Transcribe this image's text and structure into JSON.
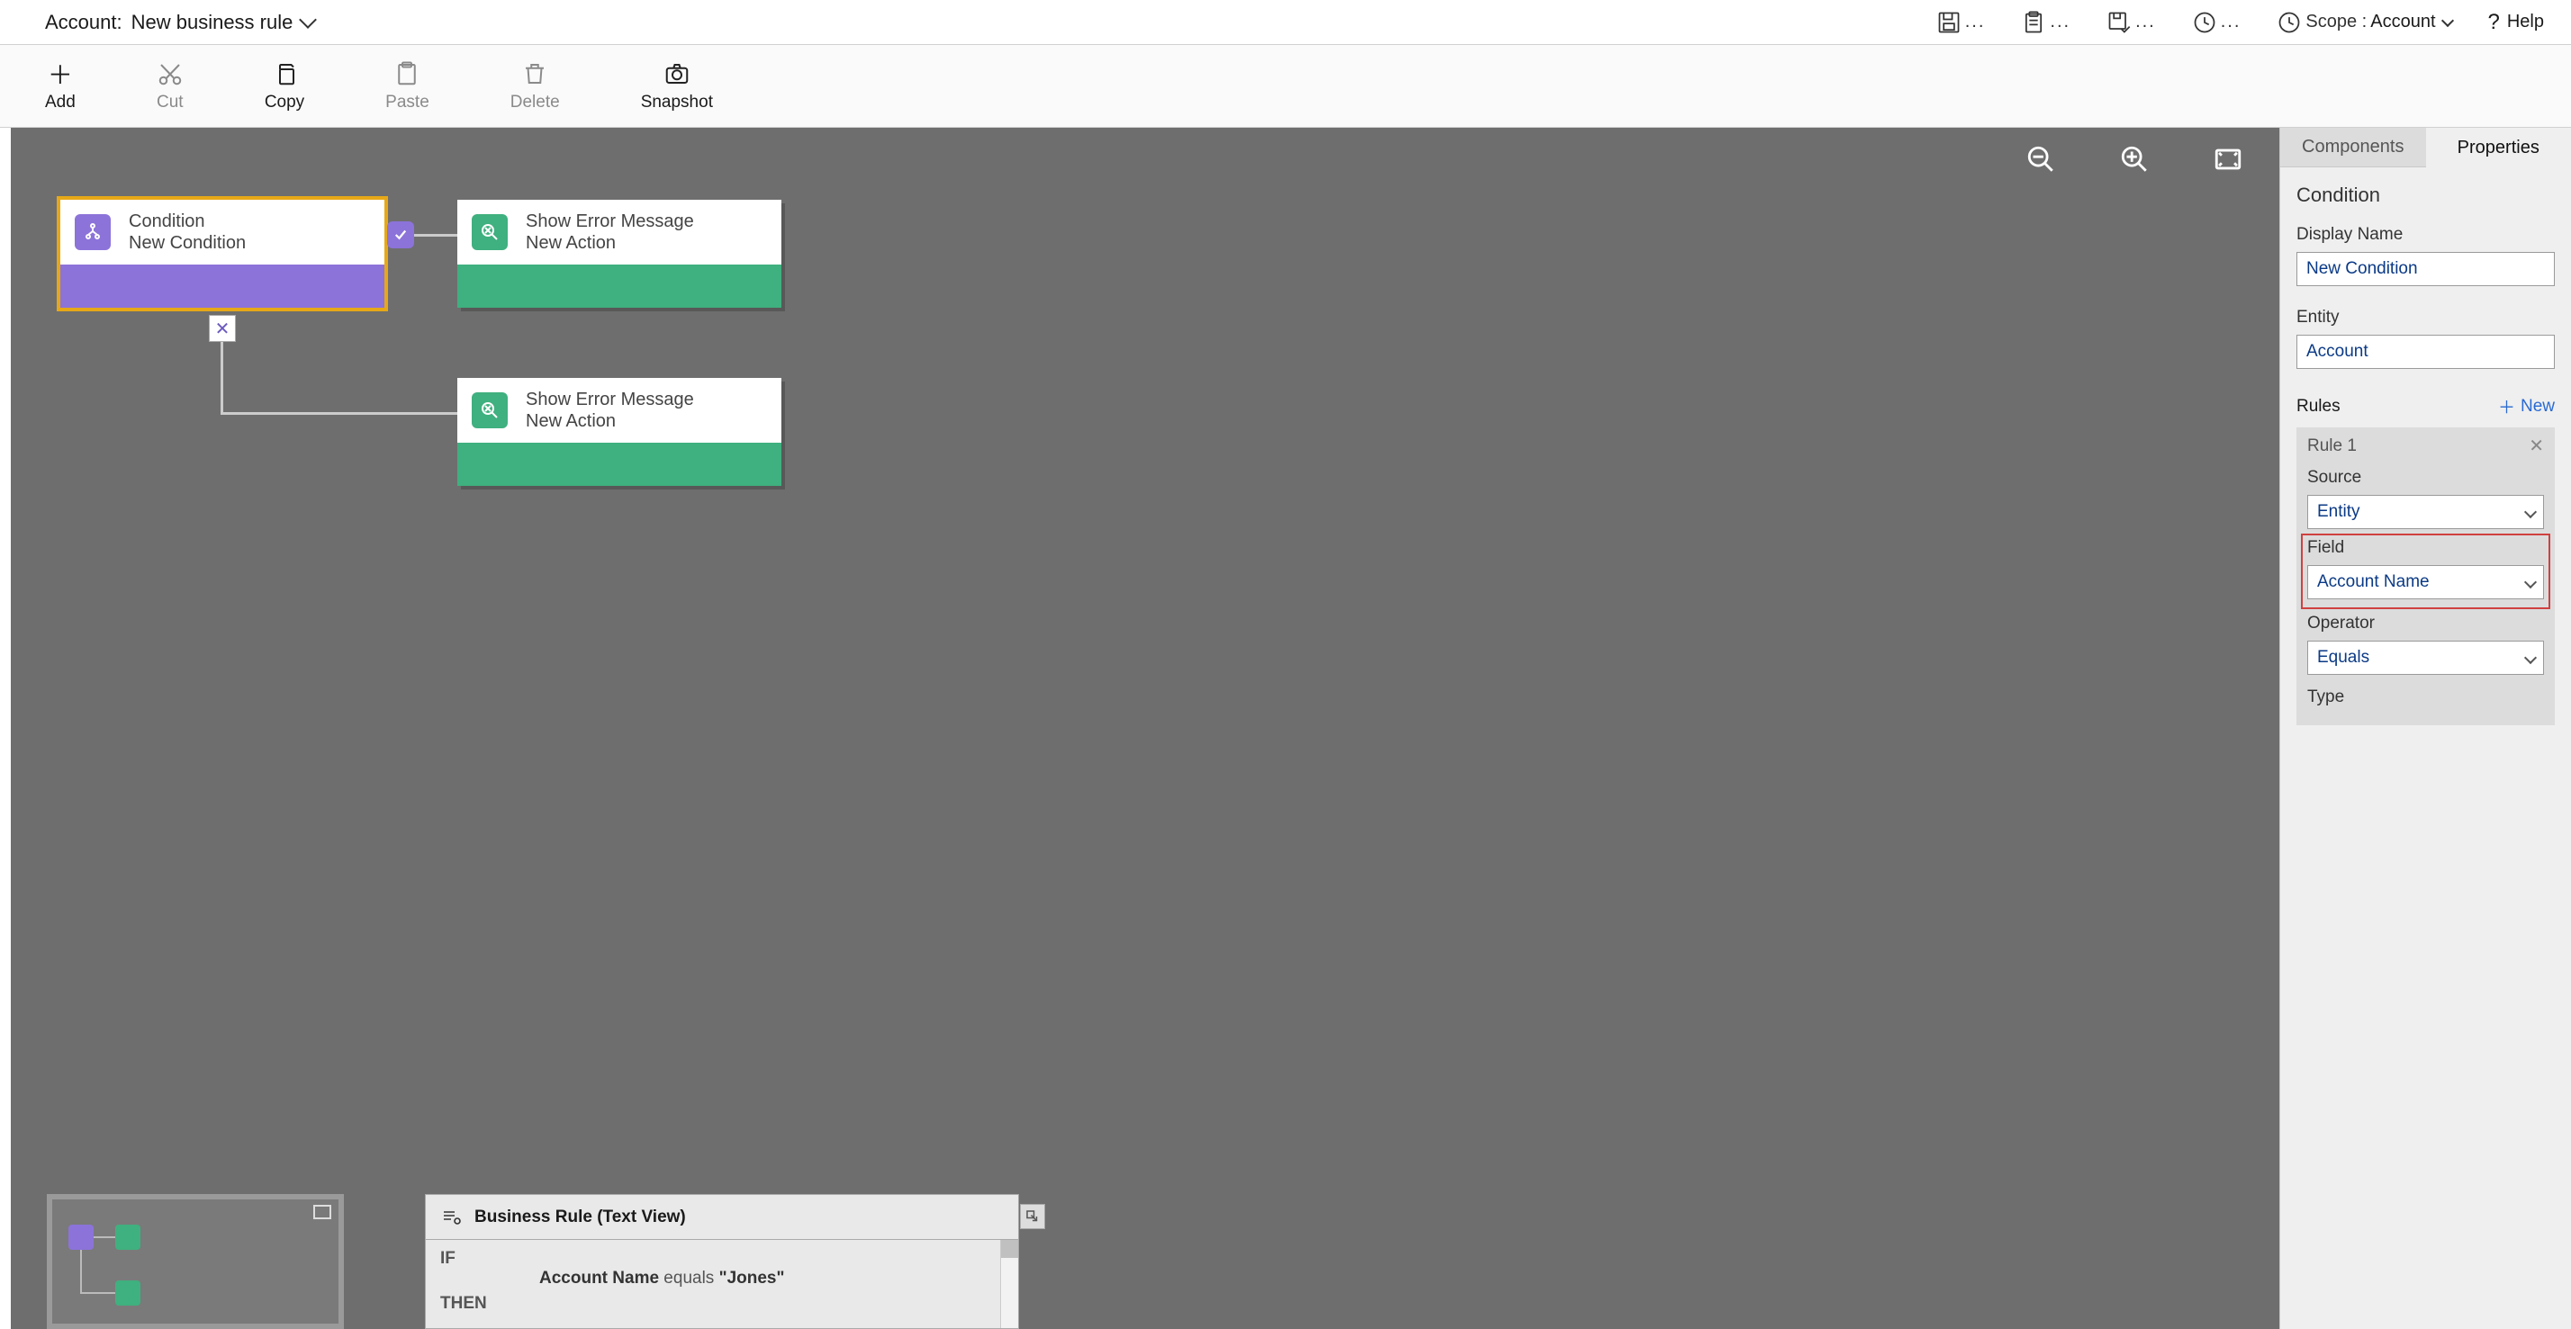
{
  "header": {
    "title_prefix": "Account:",
    "title": "New business rule",
    "scope_label": "Scope :",
    "scope_value": "Account",
    "help": "Help"
  },
  "toolbar": {
    "add": "Add",
    "cut": "Cut",
    "copy": "Copy",
    "paste": "Paste",
    "delete": "Delete",
    "snapshot": "Snapshot"
  },
  "canvas": {
    "nodes": {
      "condition": {
        "title": "Condition",
        "subtitle": "New Condition"
      },
      "action_true": {
        "title": "Show Error Message",
        "subtitle": "New Action"
      },
      "action_false": {
        "title": "Show Error Message",
        "subtitle": "New Action"
      }
    }
  },
  "textview": {
    "title": "Business Rule (Text View)",
    "if": "IF",
    "then": "THEN",
    "line_field": "Account Name",
    "line_mid": " equals ",
    "line_val": "\"Jones\""
  },
  "properties": {
    "tabs": {
      "components": "Components",
      "properties": "Properties"
    },
    "section": "Condition",
    "display_name_label": "Display Name",
    "display_name_value": "New Condition",
    "entity_label": "Entity",
    "entity_value": "Account",
    "rules_label": "Rules",
    "new_label": "New",
    "rule1_label": "Rule 1",
    "source_label": "Source",
    "source_value": "Entity",
    "field_label": "Field",
    "field_value": "Account Name",
    "operator_label": "Operator",
    "operator_value": "Equals",
    "type_label": "Type"
  }
}
